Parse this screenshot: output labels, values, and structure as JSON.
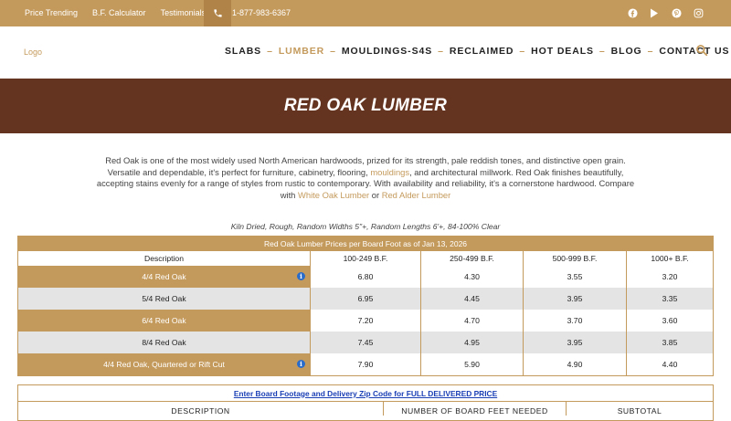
{
  "topbar": {
    "links": [
      "Price Trending",
      "B.F. Calculator",
      "Testimonials"
    ],
    "phone": "1-877-983-6367",
    "social_icons": [
      "facebook-icon",
      "youtube-icon",
      "pinterest-icon",
      "instagram-icon"
    ]
  },
  "header": {
    "logo": "Logo",
    "nav": [
      "SLABS",
      "LUMBER",
      "MOULDINGS-S4S",
      "RECLAIMED",
      "HOT DEALS",
      "BLOG",
      "CONTACT US"
    ],
    "active_nav": "LUMBER"
  },
  "banner": {
    "title": "RED OAK LUMBER"
  },
  "intro": {
    "text_1": "Red Oak is one of the most widely used North American hardwoods, prized for its strength, pale reddish tones, and distinctive open grain. Versatile and dependable, it's perfect for furniture, cabinetry, flooring, ",
    "link_mouldings": "mouldings",
    "text_2": ", and architectural millwork. Red Oak finishes beautifully, accepting stains evenly for a range of styles from rustic to contemporary. With availability and reliability, it's a cornerstone hardwood. Compare with ",
    "link_white_oak": "White Oak Lumber",
    "text_3": " or ",
    "link_red_alder": "Red Alder Lumber"
  },
  "subline": "Kiln Dried, Rough, Random Widths 5\"+, Random Lengths 6'+, 84-100% Clear",
  "price_table": {
    "title": "Red Oak Lumber Prices per Board Foot as of Jan 13, 2026",
    "headers": [
      "Description",
      "100-249 B.F.",
      "250-499 B.F.",
      "500-999 B.F.",
      "1000+ B.F."
    ],
    "rows": [
      {
        "description": "4/4 Red Oak",
        "prices": [
          "6.80",
          "4.30",
          "3.55",
          "3.20"
        ],
        "info": true
      },
      {
        "description": "5/4 Red Oak",
        "prices": [
          "6.95",
          "4.45",
          "3.95",
          "3.35"
        ],
        "info": false
      },
      {
        "description": "6/4 Red Oak",
        "prices": [
          "7.20",
          "4.70",
          "3.70",
          "3.60"
        ],
        "info": false
      },
      {
        "description": "8/4 Red Oak",
        "prices": [
          "7.45",
          "4.95",
          "3.95",
          "3.85"
        ],
        "info": false
      },
      {
        "description": "4/4 Red Oak, Quartered or Rift Cut",
        "prices": [
          "7.90",
          "5.90",
          "4.90",
          "4.40"
        ],
        "info": true
      }
    ],
    "info_glyph": "i"
  },
  "delivered": {
    "link": "Enter Board Footage and Delivery Zip Code for FULL DELIVERED PRICE",
    "headers": [
      "DESCRIPTION",
      "NUMBER OF BOARD FEET NEEDED",
      "SUBTOTAL"
    ]
  },
  "colors": {
    "tan": "#c49a5c",
    "brown": "#653420",
    "grey_row": "#e4e4e4",
    "info_blue": "#2a6cc9"
  }
}
